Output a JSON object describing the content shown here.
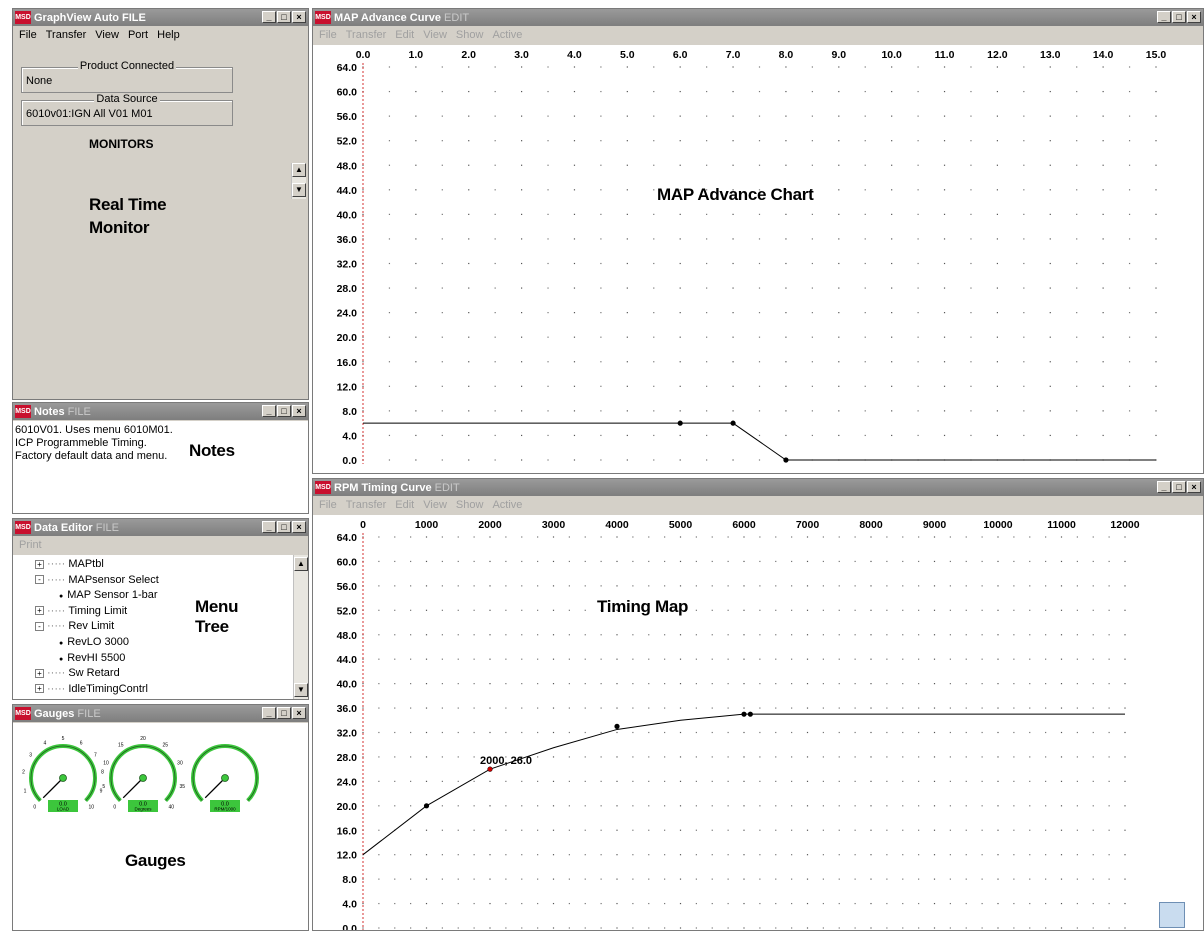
{
  "graphview": {
    "title": "GraphView Auto FILE",
    "menu": [
      "File",
      "Transfer",
      "View",
      "Port",
      "Help"
    ],
    "product_connected_label": "Product Connected",
    "product_connected_value": "None",
    "data_source_label": "Data Source",
    "data_source_value": "6010v01:IGN All V01 M01",
    "monitors_label": "MONITORS",
    "caption_line1": "Real Time",
    "caption_line2": "Monitor"
  },
  "notes": {
    "title": "Notes",
    "title_suffix": "FILE",
    "lines": [
      "6010V01.  Uses menu 6010M01.",
      "ICP Programmeble Timing.",
      "Factory default data and menu."
    ],
    "caption": "Notes"
  },
  "data_editor": {
    "title": "Data Editor",
    "title_suffix": "FILE",
    "menu": [
      "Print"
    ],
    "tree": [
      {
        "label": "MAPtbl",
        "level": 0,
        "node": "+"
      },
      {
        "label": "MAPsensor Select",
        "level": 0,
        "node": "-"
      },
      {
        "label": "MAP Sensor 1-bar",
        "level": 1,
        "node": "leaf"
      },
      {
        "label": "Timing Limit",
        "level": 0,
        "node": "+"
      },
      {
        "label": "Rev Limit",
        "level": 0,
        "node": "-"
      },
      {
        "label": "RevLO  3000",
        "level": 1,
        "node": "leaf"
      },
      {
        "label": "RevHI  5500",
        "level": 1,
        "node": "leaf"
      },
      {
        "label": "Sw Retard",
        "level": 0,
        "node": "+"
      },
      {
        "label": "IdleTimingContrl",
        "level": 0,
        "node": "+"
      }
    ],
    "caption_line1": "Menu",
    "caption_line2": "Tree"
  },
  "gauges": {
    "title": "Gauges",
    "title_suffix": "FILE",
    "caption": "Gauges",
    "items": [
      {
        "value": 0.0,
        "min": 0,
        "max": 10,
        "ticks": [
          "0",
          "1",
          "2",
          "3",
          "4",
          "5",
          "6",
          "7",
          "8",
          "9",
          "10"
        ],
        "readout": "0.0",
        "unit": "LOAD"
      },
      {
        "value": 0.0,
        "min": 0,
        "max": 40,
        "ticks": [
          "0",
          "5",
          "10",
          "15",
          "20",
          "25",
          "30",
          "35",
          "40"
        ],
        "readout": "0.0",
        "unit": "Degrees"
      },
      {
        "value": 0.0,
        "min": 0,
        "max": 10,
        "ticks": [],
        "readout": "0.0",
        "unit": "RPM/1000"
      }
    ]
  },
  "map_window": {
    "title": "MAP Advance Curve",
    "title_suffix": "EDIT",
    "menu": [
      "File",
      "Transfer",
      "Edit",
      "View",
      "Show",
      "Active"
    ],
    "caption": "MAP Advance Chart"
  },
  "rpm_window": {
    "title": "RPM Timing Curve",
    "title_suffix": "EDIT",
    "menu": [
      "File",
      "Transfer",
      "Edit",
      "View",
      "Show",
      "Active"
    ],
    "caption": "Timing Map"
  },
  "chart_data": [
    {
      "type": "line",
      "x_ticks": [
        "0.0",
        "1.0",
        "2.0",
        "3.0",
        "4.0",
        "5.0",
        "6.0",
        "7.0",
        "8.0",
        "9.0",
        "10.0",
        "11.0",
        "12.0",
        "13.0",
        "14.0",
        "15.0"
      ],
      "y_ticks": [
        "0.0",
        "4.0",
        "8.0",
        "12.0",
        "16.0",
        "20.0",
        "24.0",
        "28.0",
        "32.0",
        "36.0",
        "40.0",
        "44.0",
        "48.0",
        "52.0",
        "56.0",
        "60.0",
        "64.0"
      ],
      "xlim": [
        0,
        15
      ],
      "ylim": [
        0,
        64
      ],
      "points": [
        [
          0,
          6
        ],
        [
          6,
          6
        ],
        [
          7,
          6
        ],
        [
          8,
          0
        ],
        [
          15,
          0
        ]
      ],
      "markers": [
        [
          6,
          6
        ],
        [
          7,
          6
        ],
        [
          8,
          0
        ]
      ],
      "grid": "dotted"
    },
    {
      "type": "line",
      "x_ticks": [
        "0",
        "1000",
        "2000",
        "3000",
        "4000",
        "5000",
        "6000",
        "7000",
        "8000",
        "9000",
        "10000",
        "11000",
        "12000"
      ],
      "y_ticks": [
        "0.0",
        "4.0",
        "8.0",
        "12.0",
        "16.0",
        "20.0",
        "24.0",
        "28.0",
        "32.0",
        "36.0",
        "40.0",
        "44.0",
        "48.0",
        "52.0",
        "56.0",
        "60.0",
        "64.0"
      ],
      "xlim": [
        0,
        12000
      ],
      "ylim": [
        0,
        64
      ],
      "points": [
        [
          0,
          12
        ],
        [
          1000,
          20
        ],
        [
          2000,
          26
        ],
        [
          3000,
          29.5
        ],
        [
          4000,
          32.5
        ],
        [
          5000,
          34
        ],
        [
          6000,
          35
        ],
        [
          6100,
          35
        ],
        [
          12000,
          35
        ]
      ],
      "markers": [
        [
          1000,
          20
        ],
        [
          2000,
          26
        ],
        [
          4000,
          33
        ],
        [
          6000,
          35
        ],
        [
          6100,
          35
        ]
      ],
      "annotation": "2000, 26.0",
      "grid": "dotted"
    }
  ]
}
